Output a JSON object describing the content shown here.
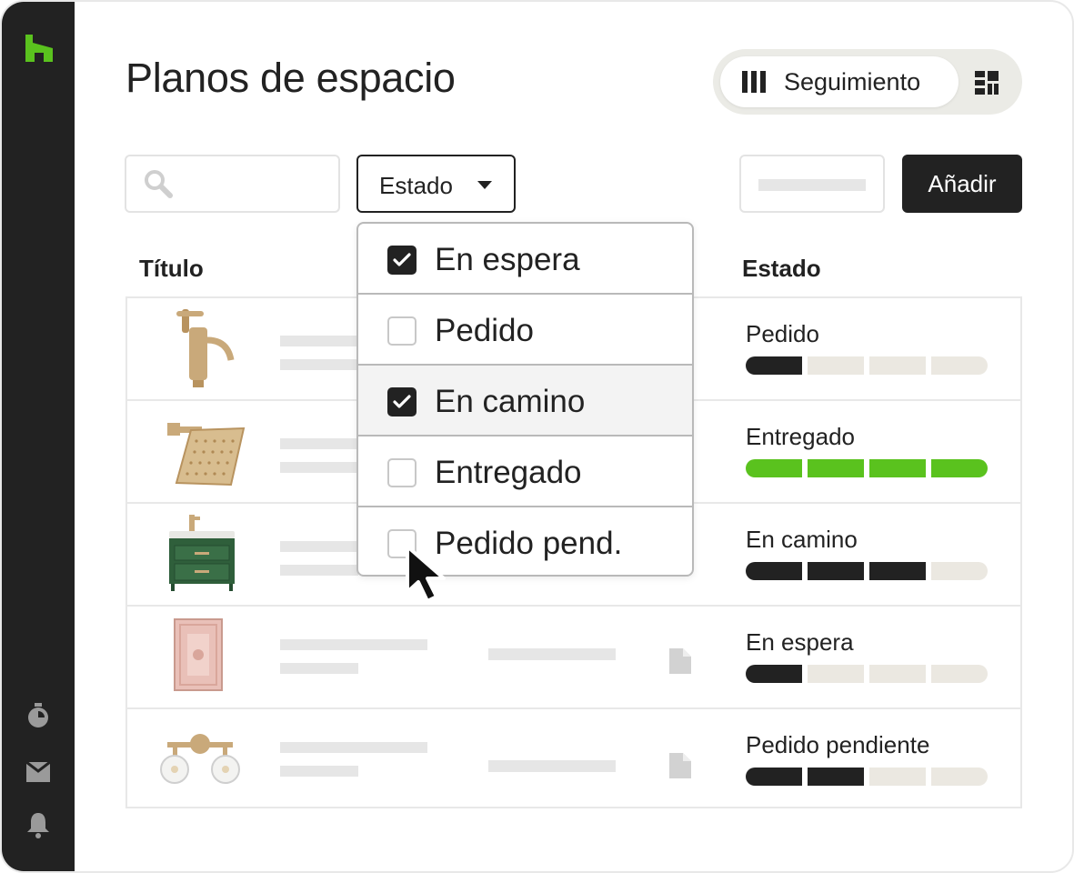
{
  "page": {
    "title": "Planos de espacio"
  },
  "view_toggle": {
    "active_label": "Seguimiento",
    "active_icon": "columns-icon",
    "other_icon": "grid-icon"
  },
  "toolbar": {
    "filter_label": "Estado",
    "add_label": "Añadir"
  },
  "table": {
    "headers": [
      "Título",
      "Estado"
    ],
    "rows": [
      {
        "thumbnail": "faucet-image",
        "status": "Pedido",
        "progress": 1,
        "color": "#222222"
      },
      {
        "thumbnail": "shower-head-image",
        "status": "Entregado",
        "progress": 4,
        "color": "#5ac21e"
      },
      {
        "thumbnail": "vanity-image",
        "status": "En camino",
        "progress": 3,
        "color": "#222222"
      },
      {
        "thumbnail": "rug-image",
        "status": "En espera",
        "progress": 1,
        "color": "#222222"
      },
      {
        "thumbnail": "light-fixture-image",
        "status": "Pedido pendiente",
        "progress": 2,
        "color": "#222222"
      }
    ]
  },
  "dropdown": {
    "options": [
      {
        "label": "En espera",
        "checked": true
      },
      {
        "label": "Pedido",
        "checked": false
      },
      {
        "label": "En camino",
        "checked": true
      },
      {
        "label": "Entregado",
        "checked": false
      },
      {
        "label": "Pedido pend.",
        "checked": false
      }
    ]
  },
  "colors": {
    "brand": "#5ac21e",
    "dark": "#222222",
    "track": "#ebe8e1"
  }
}
